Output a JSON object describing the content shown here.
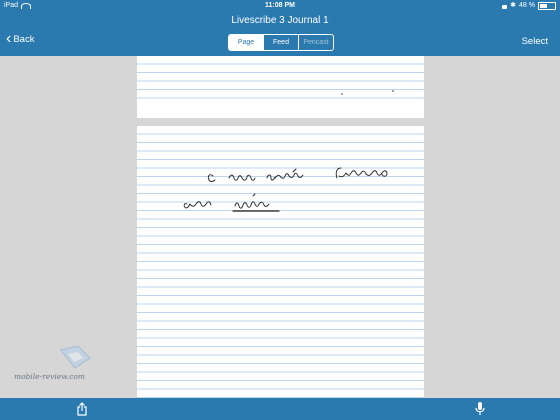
{
  "status_bar": {
    "device": "iPad",
    "time": "11:08 PM",
    "battery_percent": "48 %",
    "battery_level": 0.48
  },
  "nav": {
    "title": "Livescribe 3 Journal 1",
    "back_label": "Back",
    "select_label": "Select",
    "segments": [
      {
        "label": "Page",
        "state": "active"
      },
      {
        "label": "Feed",
        "state": "normal"
      },
      {
        "label": "Pencast",
        "state": "disabled"
      }
    ]
  },
  "watermark": {
    "text": "mobile-review.com"
  },
  "colors": {
    "bar": "#2a7ab0",
    "background": "#d6d6d6",
    "ruled_line": "#bcd6ee"
  },
  "icons": [
    "wifi-icon",
    "lock-icon",
    "bluetooth-icon",
    "battery-icon",
    "chevron-left-icon",
    "share-icon",
    "microphone-icon"
  ]
}
